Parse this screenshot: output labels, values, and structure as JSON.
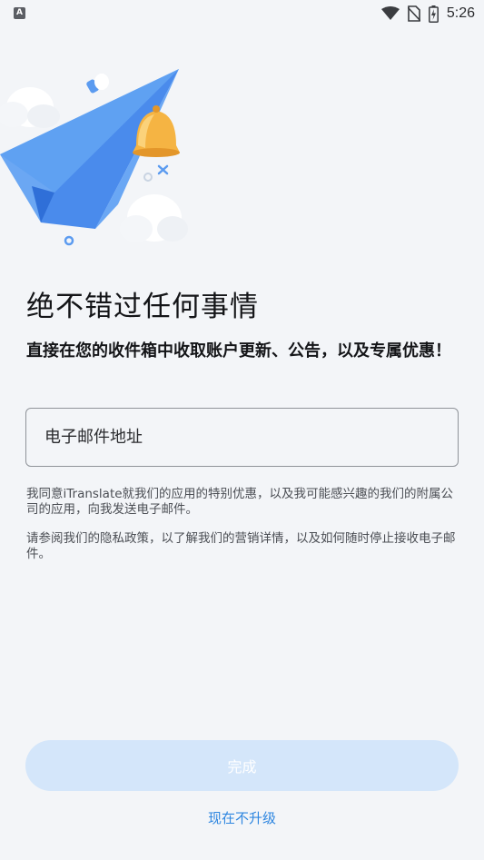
{
  "status_bar": {
    "time": "5:26",
    "left_icon_letter": "A",
    "icons": [
      "app-notification-icon",
      "wifi-icon",
      "no-sim-icon",
      "battery-charging-icon"
    ]
  },
  "hero": {
    "icons": [
      "paper-plane-icon",
      "bell-icon",
      "cloud-icon"
    ]
  },
  "content": {
    "title": "绝不错过任何事情",
    "subtitle": "直接在您的收件箱中收取账户更新、公告，以及专属优惠！",
    "email_placeholder": "电子邮件地址",
    "email_value": "",
    "consent_text": "我同意iTranslate就我们的应用的特别优惠，以及我可能感兴趣的我们的附属公司的应用，向我发送电子邮件。",
    "privacy_text": "请参阅我们的隐私政策，以了解我们的营销详情，以及如何随时停止接收电子邮件。"
  },
  "actions": {
    "done_label": "完成",
    "skip_label": "现在不升级"
  },
  "colors": {
    "background": "#f3f5f8",
    "button_disabled": "#d4e6fa",
    "link": "#2e86e0",
    "plane": "#5b9bf0",
    "bell": "#f5b443"
  }
}
